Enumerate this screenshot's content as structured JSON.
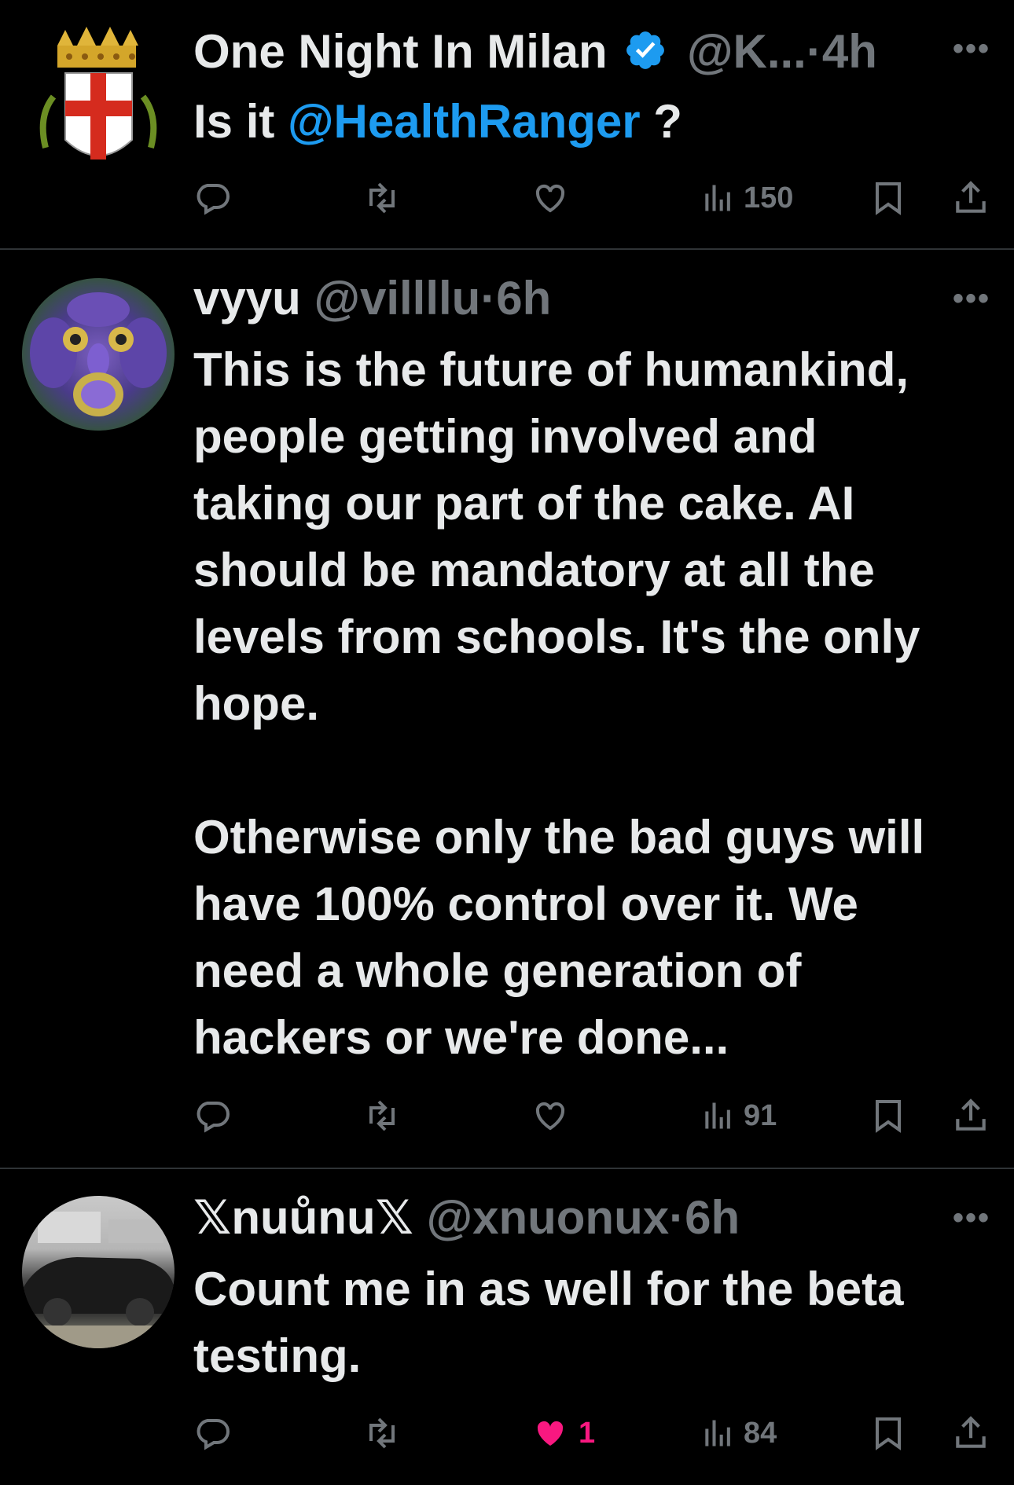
{
  "tweets": [
    {
      "name": "One Night In Milan",
      "handle": "@K...",
      "time": "4h",
      "text": "Is it",
      "mention": "@HealthRanger",
      "text_after": " ?",
      "views": "150",
      "likes": "",
      "verified": true
    },
    {
      "name": "vyyu",
      "handle": "@villllu",
      "time": "6h",
      "text": "This is the future of humankind,\npeople getting involved and\ntaking our part of the cake. AI\nshould be mandatory at all the\nlevels from schools. It's the only\nhope.\n\nOtherwise only the bad guys will\nhave 100% control over it. We\nneed a whole generation of\nhackers or we're done...",
      "views": "91",
      "likes": ""
    },
    {
      "name": "𝕏nuůnu𝕏",
      "handle": "@xnuonux",
      "time": "6h",
      "text": "Count me in as well for the beta\ntesting.",
      "views": "84",
      "likes": "1",
      "liked": true
    }
  ],
  "separator": "·",
  "icons": {
    "reply": "reply-icon",
    "retweet": "retweet-icon",
    "like": "heart-icon",
    "views": "views-icon",
    "bookmark": "bookmark-icon",
    "share": "share-icon",
    "more": "more-icon",
    "verified": "verified-badge-icon"
  },
  "colors": {
    "accent": "#1d9bf0",
    "like": "#f91880",
    "muted": "#71767b"
  }
}
